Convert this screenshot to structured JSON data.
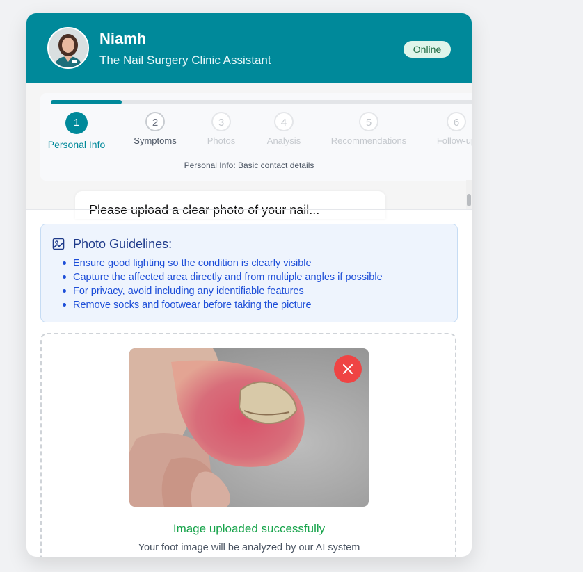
{
  "header": {
    "name": "Niamh",
    "subtitle": "The Nail Surgery Clinic Assistant",
    "status": "Online"
  },
  "progress": {
    "fraction": 0.16,
    "caption": "Personal Info: Basic contact details",
    "steps": [
      {
        "number": "1",
        "label": "Personal Info",
        "state": "active"
      },
      {
        "number": "2",
        "label": "Symptoms",
        "state": "next"
      },
      {
        "number": "3",
        "label": "Photos",
        "state": "future"
      },
      {
        "number": "4",
        "label": "Analysis",
        "state": "future"
      },
      {
        "number": "5",
        "label": "Recommendations",
        "state": "future"
      },
      {
        "number": "6",
        "label": "Follow-up",
        "state": "future"
      }
    ]
  },
  "chat": {
    "partial_message": "Please upload a clear photo of your nail..."
  },
  "guidelines": {
    "title": "Photo Guidelines:",
    "items": [
      "Ensure good lighting so the condition is clearly visible",
      "Capture the affected area directly and from multiple angles if possible",
      "For privacy, avoid including any identifiable features",
      "Remove socks and footwear before taking the picture"
    ]
  },
  "upload": {
    "success_text": "Image uploaded successfully",
    "note": "Your foot image will be analyzed by our AI system"
  },
  "colors": {
    "brand": "#00899a",
    "success": "#16a34a",
    "danger": "#ef4444",
    "info": "#1d4ed8"
  }
}
